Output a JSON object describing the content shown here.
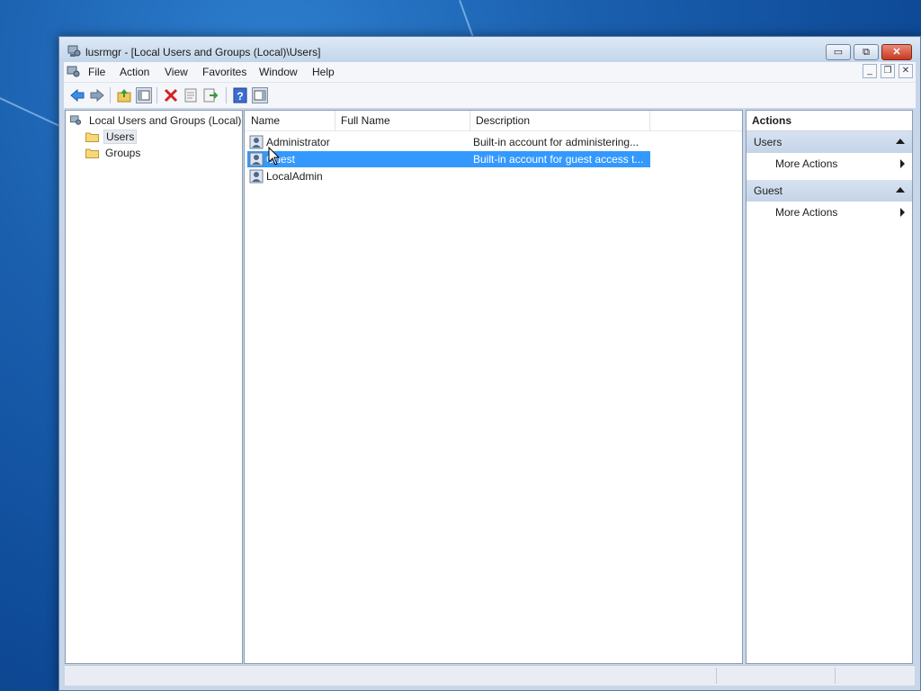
{
  "window": {
    "title": "lusrmgr - [Local Users and Groups (Local)\\Users]",
    "caption_buttons": {
      "minimize": "▭",
      "restore": "⧉",
      "close": "✕"
    }
  },
  "menubar": {
    "items": [
      "File",
      "Action",
      "View",
      "Favorites",
      "Window",
      "Help"
    ],
    "mdi_buttons": {
      "minimize": "_",
      "restore": "❐",
      "close": "✕"
    }
  },
  "toolbar": {
    "buttons": [
      "back-icon",
      "forward-icon",
      "up-one-level-icon",
      "show-hide-console-tree-icon",
      "delete-icon",
      "properties-icon",
      "export-list-icon",
      "help-icon",
      "show-hide-action-pane-icon"
    ]
  },
  "tree": {
    "root": "Local Users and Groups (Local)",
    "children": [
      {
        "label": "Users",
        "selected": true
      },
      {
        "label": "Groups",
        "selected": false
      }
    ]
  },
  "list": {
    "columns": [
      "Name",
      "Full Name",
      "Description"
    ],
    "rows": [
      {
        "name": "Administrator",
        "full_name": "",
        "description": "Built-in account for administering...",
        "selected": false
      },
      {
        "name": "Guest",
        "full_name": "",
        "description": "Built-in account for guest access t...",
        "selected": true
      },
      {
        "name": "LocalAdmin",
        "full_name": "",
        "description": "",
        "selected": false
      }
    ]
  },
  "actions": {
    "title": "Actions",
    "groups": [
      {
        "label": "Users",
        "items": [
          "More Actions"
        ]
      },
      {
        "label": "Guest",
        "items": [
          "More Actions"
        ]
      }
    ]
  },
  "colors": {
    "selection": "#3399ff",
    "group_header": "#c4d4e8",
    "desktop": "#1a5fae"
  }
}
